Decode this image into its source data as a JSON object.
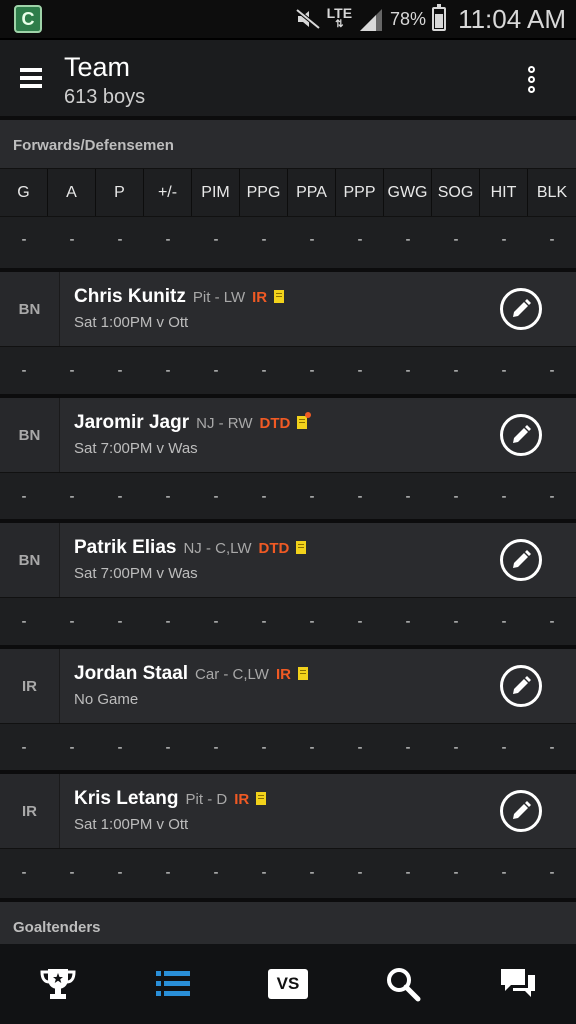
{
  "status_bar": {
    "network": "LTE",
    "battery_percent": "78%",
    "battery_level": 0.78,
    "time": "11:04 AM"
  },
  "app_bar": {
    "title": "Team",
    "subtitle": "613 boys"
  },
  "forwards_section": {
    "label": "Forwards/Defensemen",
    "stat_columns": [
      "G",
      "A",
      "P",
      "+/-",
      "PIM",
      "PPG",
      "PPA",
      "PPP",
      "GWG",
      "SOG",
      "HIT",
      "BLK"
    ],
    "header_totals": [
      "-",
      "-",
      "-",
      "-",
      "-",
      "-",
      "-",
      "-",
      "-",
      "-",
      "-",
      "-"
    ],
    "players": [
      {
        "slot": "BN",
        "name": "Chris Kunitz",
        "team_pos": "Pit - LW",
        "status": "IR",
        "game": "Sat 1:00PM v Ott",
        "news_alert": false,
        "stats": [
          "-",
          "-",
          "-",
          "-",
          "-",
          "-",
          "-",
          "-",
          "-",
          "-",
          "-",
          "-"
        ]
      },
      {
        "slot": "BN",
        "name": "Jaromir Jagr",
        "team_pos": "NJ - RW",
        "status": "DTD",
        "game": "Sat 7:00PM v Was",
        "news_alert": true,
        "stats": [
          "-",
          "-",
          "-",
          "-",
          "-",
          "-",
          "-",
          "-",
          "-",
          "-",
          "-",
          "-"
        ]
      },
      {
        "slot": "BN",
        "name": "Patrik Elias",
        "team_pos": "NJ - C,LW",
        "status": "DTD",
        "game": "Sat 7:00PM v Was",
        "news_alert": false,
        "stats": [
          "-",
          "-",
          "-",
          "-",
          "-",
          "-",
          "-",
          "-",
          "-",
          "-",
          "-",
          "-"
        ]
      },
      {
        "slot": "IR",
        "name": "Jordan Staal",
        "team_pos": "Car - C,LW",
        "status": "IR",
        "game": "No Game",
        "news_alert": false,
        "stats": [
          "-",
          "-",
          "-",
          "-",
          "-",
          "-",
          "-",
          "-",
          "-",
          "-",
          "-",
          "-"
        ]
      },
      {
        "slot": "IR",
        "name": "Kris Letang",
        "team_pos": "Pit - D",
        "status": "IR",
        "game": "Sat 1:00PM v Ott",
        "news_alert": false,
        "stats": [
          "-",
          "-",
          "-",
          "-",
          "-",
          "-",
          "-",
          "-",
          "-",
          "-",
          "-",
          "-"
        ]
      }
    ]
  },
  "goaltenders_section": {
    "label": "Goaltenders"
  },
  "bottom_nav": {
    "items": [
      {
        "icon": "trophy-icon",
        "active": false
      },
      {
        "icon": "list-icon",
        "active": true
      },
      {
        "icon": "vs-icon",
        "label": "VS",
        "active": false
      },
      {
        "icon": "search-icon",
        "active": false
      },
      {
        "icon": "chat-icon",
        "active": false
      }
    ]
  },
  "colors": {
    "status_alert": "#f05a24",
    "news_icon": "#f2d21b",
    "active_nav": "#2a8fd8",
    "background": "#1e1f21"
  }
}
